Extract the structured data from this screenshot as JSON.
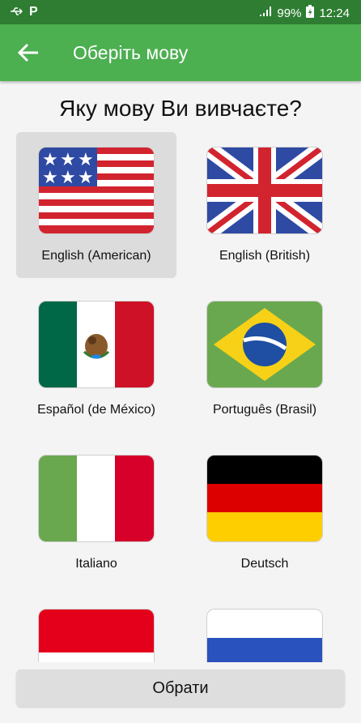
{
  "status_bar": {
    "battery": "99%",
    "time": "12:24"
  },
  "app_bar": {
    "title": "Оберіть мову"
  },
  "question": "Яку мову Ви вивчаєте?",
  "languages": [
    {
      "label": "English (American)",
      "flag_icon": "us-flag-icon",
      "selected": true
    },
    {
      "label": "English (British)",
      "flag_icon": "uk-flag-icon",
      "selected": false
    },
    {
      "label": "Español (de México)",
      "flag_icon": "mexico-flag-icon",
      "selected": false
    },
    {
      "label": "Português (Brasil)",
      "flag_icon": "brazil-flag-icon",
      "selected": false
    },
    {
      "label": "Italiano",
      "flag_icon": "italy-flag-icon",
      "selected": false
    },
    {
      "label": "Deutsch",
      "flag_icon": "germany-flag-icon",
      "selected": false
    },
    {
      "label": "",
      "flag_icon": "indonesia-flag-icon",
      "selected": false
    },
    {
      "label": "",
      "flag_icon": "netherlands-flag-icon",
      "selected": false
    }
  ],
  "select_button": "Обрати",
  "colors": {
    "status_bar": "#2e7d32",
    "app_bar": "#4caf50",
    "selected_cell": "#dcdcdc"
  }
}
